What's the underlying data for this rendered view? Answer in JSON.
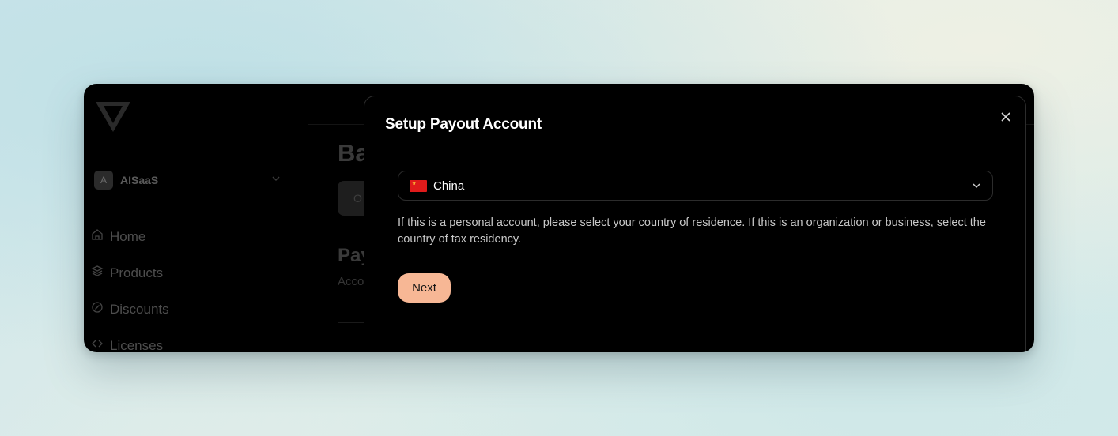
{
  "background_app": {
    "workspace": {
      "avatar_letter": "A",
      "name": "AISaaS"
    },
    "nav": [
      {
        "label": "Home",
        "icon": "home-icon"
      },
      {
        "label": "Products",
        "icon": "layers-icon"
      },
      {
        "label": "Discounts",
        "icon": "discount-icon"
      },
      {
        "label": "Licenses",
        "icon": "code-icon"
      }
    ],
    "main": {
      "title_partial": "Ba",
      "pill_partial": "O",
      "section_title_partial": "Pay",
      "section_sub_partial": "Acco"
    }
  },
  "modal": {
    "title": "Setup Payout Account",
    "country_select": {
      "flag_icon": "china-flag-icon",
      "value": "China"
    },
    "help_text": "If this is a personal account, please select your country of residence. If this is an organization or business, select the country of tax residency.",
    "next_label": "Next"
  },
  "colors": {
    "accent": "#f7b795",
    "modal_bg": "#000000",
    "border": "#2c2c2c"
  }
}
